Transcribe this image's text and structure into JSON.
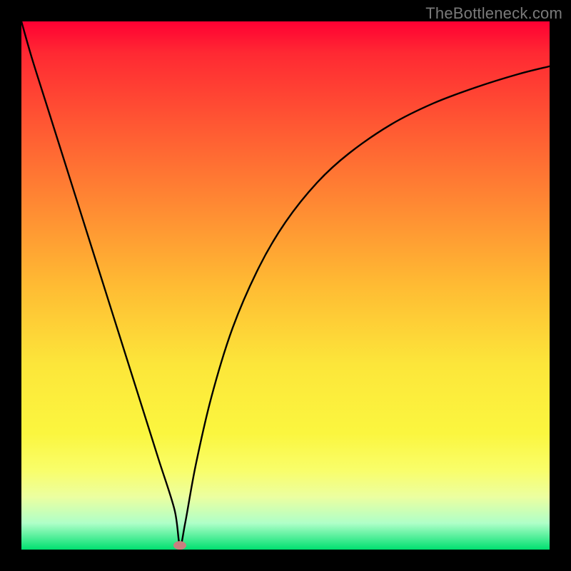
{
  "watermark": "TheBottleneck.com",
  "chart_data": {
    "type": "line",
    "title": "",
    "xlabel": "",
    "ylabel": "",
    "xlim": [
      0,
      100
    ],
    "ylim": [
      0,
      100
    ],
    "grid": false,
    "legend": false,
    "x": [
      0,
      2,
      5,
      8,
      11,
      14,
      17,
      20,
      23,
      26,
      29,
      30,
      31,
      33,
      36,
      40,
      45,
      50,
      56,
      62,
      70,
      78,
      86,
      94,
      100
    ],
    "y": [
      100,
      93,
      83.5,
      74,
      64.5,
      55,
      45.5,
      36,
      26.5,
      17,
      7.5,
      0.8,
      5,
      16,
      29,
      42,
      53.5,
      62,
      69.5,
      75,
      80.5,
      84.5,
      87.5,
      90,
      91.5
    ],
    "minimum_marker": {
      "x": 30,
      "y": 0.8,
      "color": "#c97f7f"
    }
  }
}
